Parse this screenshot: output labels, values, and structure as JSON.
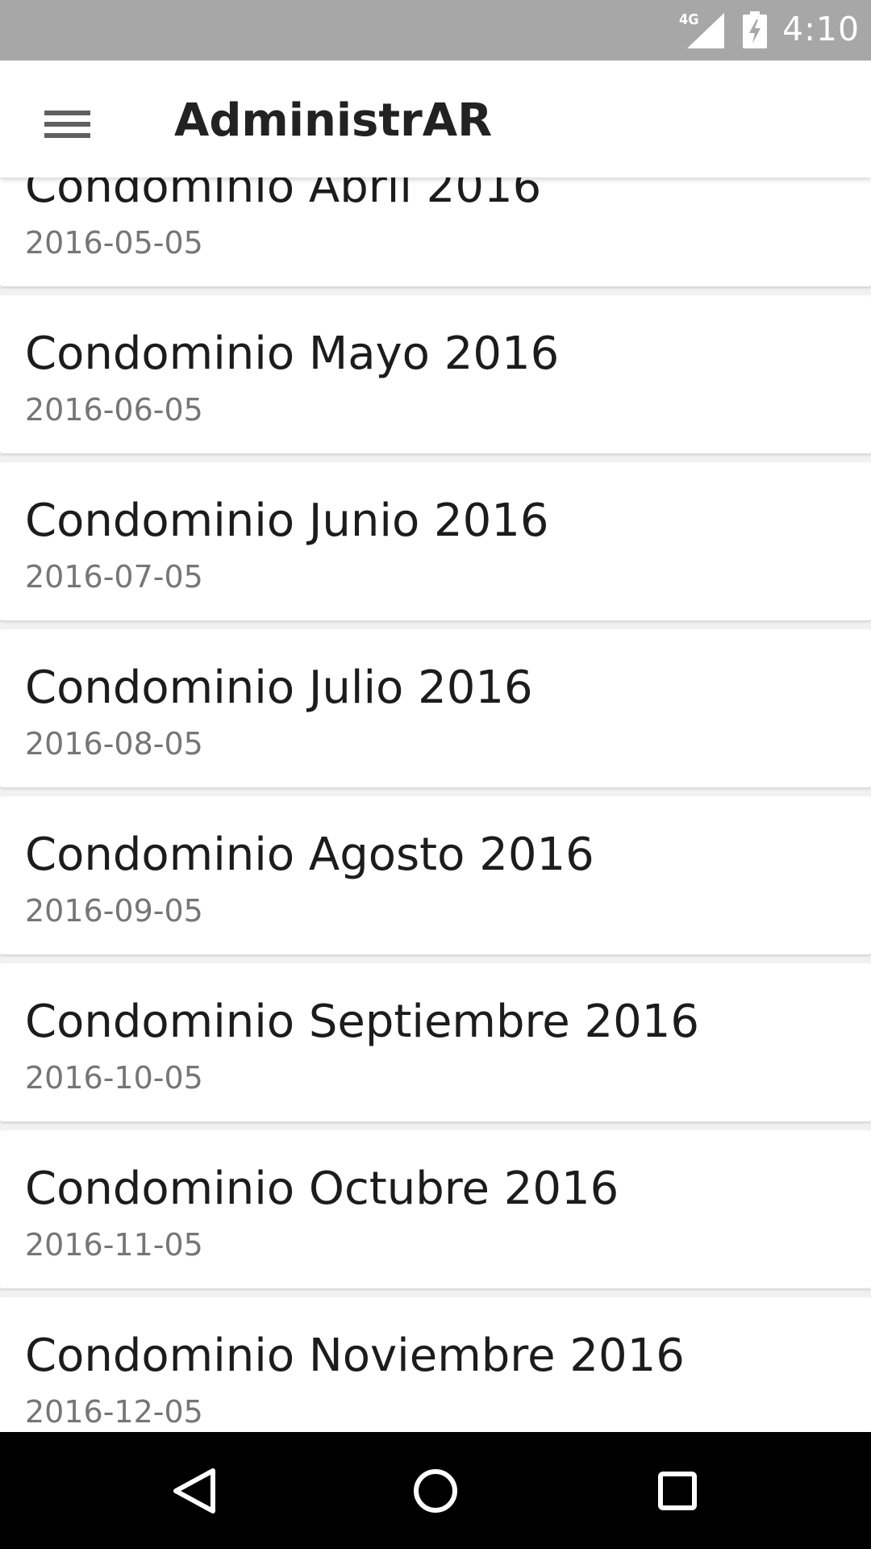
{
  "status_bar": {
    "network": "4G",
    "time": "4:10",
    "icons": [
      "signal-icon",
      "battery-charging-icon"
    ]
  },
  "app_bar": {
    "title": "AdministrAR",
    "menu_icon": "hamburger-menu-icon"
  },
  "list": {
    "items": [
      {
        "title": "Condominio Abril 2016",
        "date": "2016-05-05"
      },
      {
        "title": "Condominio Mayo 2016",
        "date": "2016-06-05"
      },
      {
        "title": "Condominio Junio 2016",
        "date": "2016-07-05"
      },
      {
        "title": "Condominio Julio 2016",
        "date": "2016-08-05"
      },
      {
        "title": "Condominio Agosto 2016",
        "date": "2016-09-05"
      },
      {
        "title": "Condominio Septiembre 2016",
        "date": "2016-10-05"
      },
      {
        "title": "Condominio Octubre 2016",
        "date": "2016-11-05"
      },
      {
        "title": "Condominio Noviembre 2016",
        "date": "2016-12-05"
      }
    ]
  },
  "nav_bar": {
    "icons": [
      "back-icon",
      "home-icon",
      "recents-icon"
    ]
  }
}
